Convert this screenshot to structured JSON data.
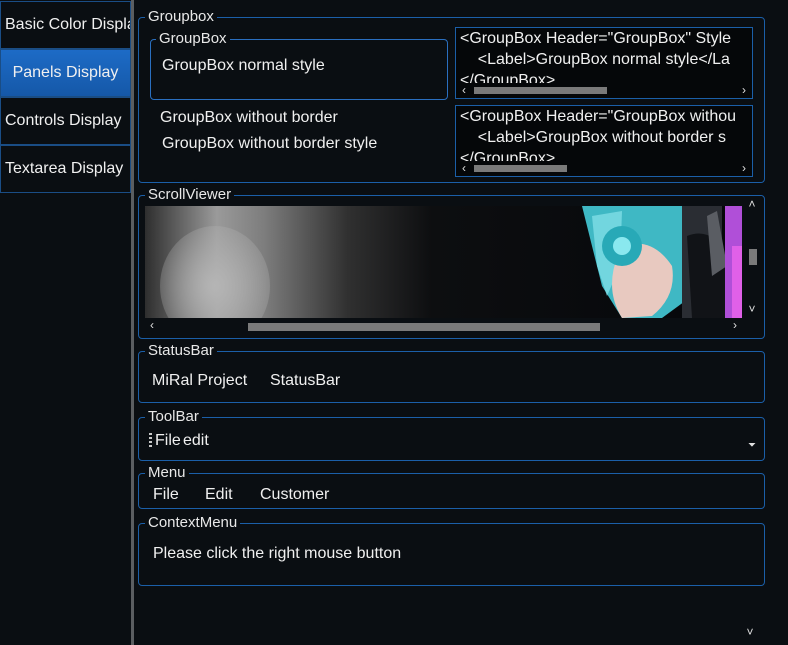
{
  "sidebar": {
    "items": [
      {
        "label": "Basic Color Display",
        "active": false
      },
      {
        "label": "Panels Display",
        "active": true
      },
      {
        "label": "Controls Display",
        "active": false
      },
      {
        "label": "Textarea Display",
        "active": false
      }
    ]
  },
  "groupbox": {
    "title": "Groupbox",
    "normal": {
      "header": "GroupBox",
      "label": "GroupBox normal style",
      "code": [
        "<GroupBox Header=\"GroupBox\" Style",
        "    <Label>GroupBox normal style</La",
        "</GroupBox>"
      ]
    },
    "no_border": {
      "header": "GroupBox without border",
      "label": "GroupBox without border style",
      "code": [
        "<GroupBox Header=\"GroupBox withou",
        "    <Label>GroupBox without border s",
        "</GroupBox>"
      ]
    }
  },
  "scrollviewer": {
    "title": "ScrollViewer"
  },
  "statusbar": {
    "title": "StatusBar",
    "items": [
      "MiRal Project",
      "StatusBar"
    ]
  },
  "toolbar": {
    "title": "ToolBar",
    "items": [
      "File",
      "edit"
    ],
    "overflow_icon": "chevron-down-icon"
  },
  "menu": {
    "title": "Menu",
    "items": [
      "File",
      "Edit",
      "Customer"
    ]
  },
  "contextmenu": {
    "title": "ContextMenu",
    "text": "Please click the right mouse button"
  },
  "colors": {
    "accent": "#1d6bc6",
    "border": "#1b5fa8",
    "background": "#0a0e12"
  }
}
